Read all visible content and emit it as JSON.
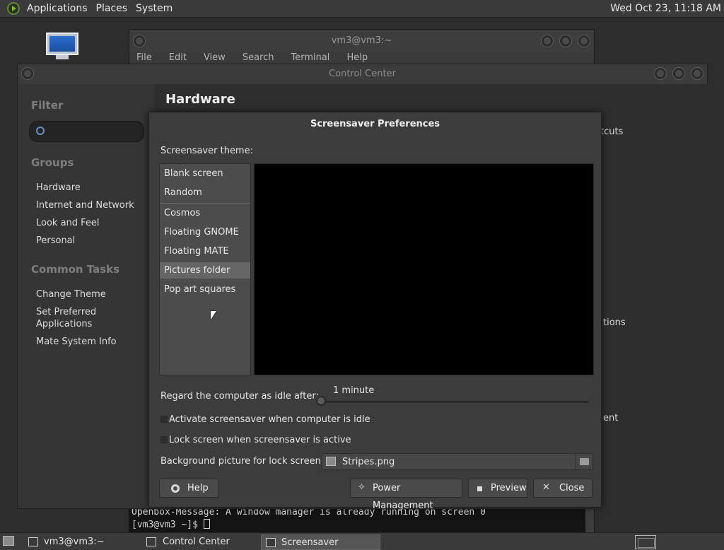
{
  "top_panel": {
    "menus": [
      "Applications",
      "Places",
      "System"
    ],
    "clock": "Wed Oct 23, 11:18 AM"
  },
  "terminal": {
    "title": "vm3@vm3:~",
    "menu": [
      "File",
      "Edit",
      "View",
      "Search",
      "Terminal",
      "Help"
    ],
    "lines": [
      "Openbox-Message: A window manager is already running on screen 0",
      "[vm3@vm3 ~]$ "
    ]
  },
  "control_center": {
    "title": "Control Center",
    "filter_heading": "Filter",
    "groups_heading": "Groups",
    "groups": [
      "Hardware",
      "Internet and Network",
      "Look and Feel",
      "Personal"
    ],
    "tasks_heading": "Common Tasks",
    "tasks": [
      "Change Theme",
      "Set Preferred Applications",
      "Mate System Info"
    ],
    "main_title": "Hardware",
    "partial_labels": [
      "tcuts",
      "tions",
      "ent"
    ]
  },
  "screensaver": {
    "title": "Screensaver Preferences",
    "theme_label": "Screensaver theme:",
    "themes": [
      "Blank screen",
      "Random",
      "Cosmos",
      "Floating GNOME",
      "Floating MATE",
      "Pictures folder",
      "Pop art squares"
    ],
    "selected_theme": "Pictures folder",
    "idle_label": "Regard the computer as idle after:",
    "idle_value": "1 minute",
    "idle_fraction": 0.0,
    "activate_label": "Activate screensaver when computer is idle",
    "activate_checked": false,
    "lock_label": "Lock screen when screensaver is active",
    "lock_checked": false,
    "bg_label": "Background picture for lock screen:",
    "bg_value": "Stripes.png",
    "buttons": {
      "help": "Help",
      "power": "Power Management",
      "preview": "Preview",
      "close": "Close"
    }
  },
  "taskbar": {
    "items": [
      "vm3@vm3:~",
      "Control Center",
      "Screensaver Prefere..."
    ],
    "active_index": 2
  }
}
